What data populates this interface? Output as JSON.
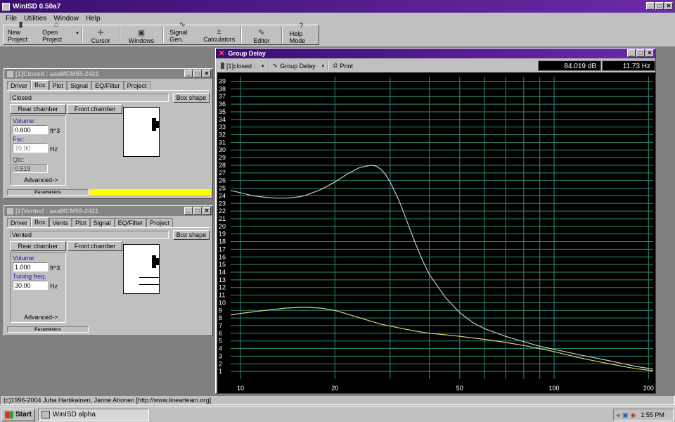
{
  "app": {
    "title": "WinISD 0.50a7",
    "window_buttons": [
      "_",
      "□",
      "✕"
    ]
  },
  "menu": [
    "File",
    "Utilities",
    "Window",
    "Help"
  ],
  "toolbar": {
    "new_project": "New Project",
    "open_project": "Open Project",
    "cursor": "Cursor",
    "windows": "Windows",
    "signal_gen": "Signal Gen.",
    "calculators": "Calculators",
    "editor": "Editor",
    "help_mode": "Help Mode"
  },
  "closed_window": {
    "title": "[1]Closed : aaaMCM55-2421",
    "tabs": [
      "Driver",
      "Box",
      "Plot",
      "Signal",
      "EQ/Filter",
      "Project"
    ],
    "active_tab": "Box",
    "box_type": "Closed",
    "box_shape_button": "Box shape",
    "rear_chamber": "Rear chamber",
    "front_chamber": "Front chamber",
    "volume_label": "Volume:",
    "volume_value": "0.600",
    "volume_unit": "ft^3",
    "fsc_label": "Fsc:",
    "fsc_value": "70.90",
    "fsc_unit": "Hz",
    "qtc_label": "Qtc:",
    "qtc_value": "0.519",
    "advanced": "Advanced->",
    "parameters": "Parameters"
  },
  "vented_window": {
    "title": "[2]Vented : aaaMCM55-2421",
    "tabs": [
      "Driver",
      "Box",
      "Vents",
      "Plot",
      "Signal",
      "EQ/Filter",
      "Project"
    ],
    "active_tab": "Box",
    "box_type": "Vented",
    "box_shape_button": "Box shape",
    "rear_chamber": "Rear chamber",
    "front_chamber": "Front chamber",
    "volume_label": "Volume:",
    "volume_value": "1.000",
    "volume_unit": "ft^3",
    "tuning_label": "Tuning freq.",
    "tuning_value": "30.00",
    "tuning_unit": "Hz",
    "advanced": "Advanced->",
    "parameters": "Parameters"
  },
  "group_delay": {
    "title": "Group Delay",
    "project_select": "[1]closed :",
    "plot_select": "Group Delay",
    "print": "Print",
    "readout_db": "84.019 dB",
    "readout_hz": "11.73 Hz"
  },
  "chart_data": {
    "type": "line",
    "x_scale": "log",
    "xlim": [
      9.3,
      207
    ],
    "ylim": [
      0,
      39.6
    ],
    "x_ticks": [
      10,
      20,
      50,
      100,
      200
    ],
    "y_ticks": [
      1,
      2,
      3,
      4,
      5,
      6,
      7,
      8,
      9,
      10,
      11,
      12,
      13,
      14,
      15,
      16,
      17,
      18,
      19,
      20,
      21,
      22,
      23,
      24,
      25,
      26,
      27,
      28,
      29,
      30,
      31,
      32,
      33,
      34,
      35,
      36,
      37,
      38,
      39
    ],
    "grid": true,
    "colors": {
      "background": "#000000",
      "grid": "#2e8b78",
      "axis_text": "#ffffff",
      "closed": "#c8c8c8",
      "vented": "#d6d67a"
    },
    "series": [
      {
        "x": [
          9.3,
          10,
          11,
          12,
          13,
          14,
          15,
          16,
          18,
          20,
          22,
          24,
          26,
          27,
          28,
          29,
          30,
          32,
          34,
          36,
          38,
          40,
          45,
          50,
          55,
          60,
          70,
          80,
          90,
          100,
          120,
          150,
          180,
          207
        ],
        "y": [
          24.7,
          24.4,
          24.0,
          23.8,
          23.7,
          23.7,
          23.8,
          24.0,
          24.8,
          25.8,
          26.9,
          27.7,
          28.0,
          27.9,
          27.5,
          26.8,
          25.8,
          23.4,
          20.6,
          17.9,
          15.6,
          13.7,
          10.7,
          8.7,
          7.4,
          6.6,
          5.6,
          4.9,
          4.3,
          3.9,
          3.2,
          2.4,
          1.7,
          1.3
        ]
      },
      {
        "x": [
          9.3,
          10,
          12,
          14,
          16,
          18,
          20,
          22,
          25,
          28,
          32,
          36,
          40,
          45,
          50,
          60,
          70,
          80,
          90,
          100,
          120,
          150,
          180,
          207
        ],
        "y": [
          8.4,
          8.6,
          9.0,
          9.3,
          9.4,
          9.3,
          9.0,
          8.5,
          7.8,
          7.2,
          6.7,
          6.3,
          6.0,
          5.8,
          5.6,
          5.2,
          4.8,
          4.4,
          4.0,
          3.6,
          2.8,
          2.0,
          1.4,
          1.1
        ]
      }
    ]
  },
  "status": "(c)1996-2004 Juha Hartikainen, Janne Ahonen [http://www.linearteam.org]",
  "taskbar": {
    "start": "Start",
    "task": "WinISD alpha",
    "clock": "1:55 PM"
  }
}
